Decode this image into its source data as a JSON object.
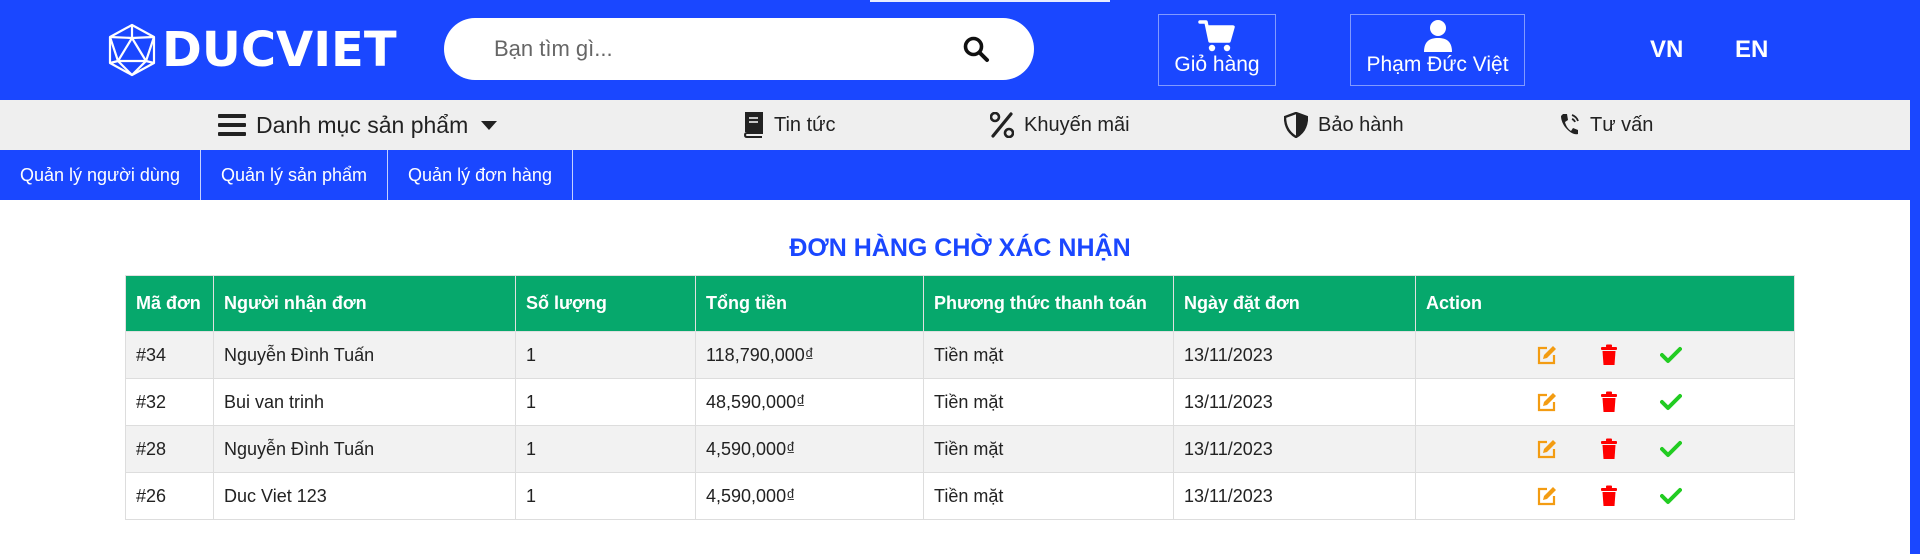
{
  "header": {
    "logo_text": "DUCVIET",
    "search_placeholder": "Bạn tìm gì...",
    "cart_label": "Giỏ hàng",
    "user_label": "Phạm Đức Việt",
    "lang_vn": "VN",
    "lang_en": "EN"
  },
  "category_nav": {
    "menu_label": "Danh mục sản phẩm",
    "items": [
      {
        "label": "Tin tức",
        "icon": "book-icon"
      },
      {
        "label": "Khuyến mãi",
        "icon": "percent-icon"
      },
      {
        "label": "Bảo hành",
        "icon": "shield-icon"
      },
      {
        "label": "Tư vấn",
        "icon": "phone-icon"
      }
    ]
  },
  "admin_nav": {
    "tabs": [
      "Quản lý người dùng",
      "Quản lý sản phẩm",
      "Quản lý đơn hàng"
    ]
  },
  "main": {
    "title": "ĐƠN HÀNG CHỜ XÁC NHẬN",
    "columns": [
      "Mã đơn",
      "Người nhận đơn",
      "Số lượng",
      "Tổng tiền",
      "Phương thức thanh toán",
      "Ngày đặt đơn",
      "Action"
    ],
    "rows": [
      {
        "id": "#34",
        "receiver": "Nguyễn Đình Tuấn",
        "qty": "1",
        "total": "118,790,000₫",
        "payment": "Tiền mặt",
        "date": "13/11/2023"
      },
      {
        "id": "#32",
        "receiver": "Bui van trinh",
        "qty": "1",
        "total": "48,590,000₫",
        "payment": "Tiền mặt",
        "date": "13/11/2023"
      },
      {
        "id": "#28",
        "receiver": "Nguyễn Đình Tuấn",
        "qty": "1",
        "total": "4,590,000₫",
        "payment": "Tiền mặt",
        "date": "13/11/2023"
      },
      {
        "id": "#26",
        "receiver": "Duc Viet 123",
        "qty": "1",
        "total": "4,590,000₫",
        "payment": "Tiền mặt",
        "date": "13/11/2023"
      }
    ]
  },
  "colors": {
    "brand_blue": "#1a47ff",
    "table_header_green": "#06a86c",
    "edit_orange": "#f39c12",
    "delete_red": "#ff0000",
    "confirm_green": "#22cc22"
  }
}
